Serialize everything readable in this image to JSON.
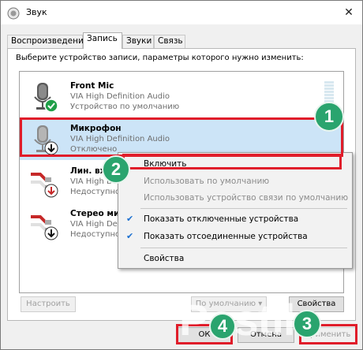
{
  "window": {
    "title": "Звук"
  },
  "tabs": [
    {
      "label": "Воспроизведение"
    },
    {
      "label": "Запись"
    },
    {
      "label": "Звуки"
    },
    {
      "label": "Связь"
    }
  ],
  "panel": {
    "instruction": "Выберите устройство записи, параметры которого нужно изменить:"
  },
  "devices": [
    {
      "name": "Front Mic",
      "driver": "VIA High Definition Audio",
      "status": "Устройство по умолчанию"
    },
    {
      "name": "Микрофон",
      "driver": "VIA High Definition Audio",
      "status": "Отключено"
    },
    {
      "name": "Лин. вход",
      "driver": "VIA High Definition Audio",
      "status": "Недоступно"
    },
    {
      "name": "Стерео микшер",
      "driver": "VIA High Definition Audio",
      "status": "Недоступно"
    }
  ],
  "context_menu": {
    "items": [
      {
        "label": "Включить"
      },
      {
        "label": "Использовать по умолчанию"
      },
      {
        "label": "Использовать устройство связи по умолчанию"
      },
      {
        "label": "Показать отключенные устройства"
      },
      {
        "label": "Показать отсоединенные устройства"
      },
      {
        "label": "Свойства"
      }
    ]
  },
  "buttons": {
    "configure": "Настроить",
    "default": "По умолчанию",
    "properties": "Свойства",
    "ok": "ОК",
    "cancel": "Отмена",
    "apply": "Применить"
  },
  "badges": [
    "1",
    "2",
    "3",
    "4"
  ],
  "watermark": "Postila",
  "colors": {
    "highlight": "#e01d2a",
    "badge": "#2aa46e",
    "selected_row": "#cce4f7",
    "check": "#1a6fd0"
  }
}
